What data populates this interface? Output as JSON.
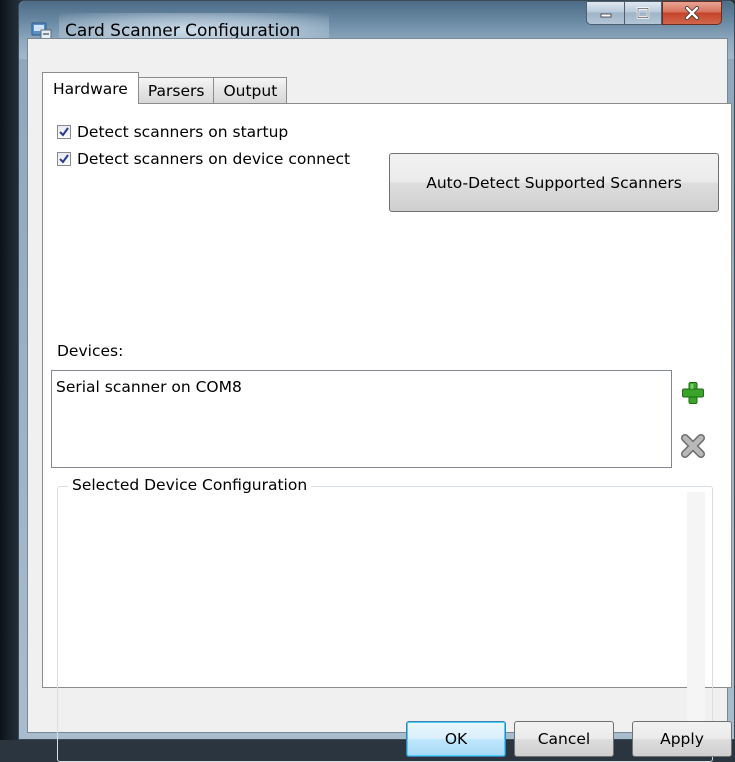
{
  "window": {
    "title": "Card Scanner Configuration"
  },
  "tabs": [
    {
      "label": "Hardware",
      "active": true
    },
    {
      "label": "Parsers",
      "active": false
    },
    {
      "label": "Output",
      "active": false
    }
  ],
  "hardware": {
    "detect_startup_label": "Detect scanners on startup",
    "detect_startup_checked": true,
    "detect_connect_label": "Detect scanners on device connect",
    "detect_connect_checked": true,
    "autodetect_label": "Auto-Detect Supported Scanners",
    "devices_label": "Devices:",
    "devices": [
      "Serial scanner on COM8"
    ],
    "selected_config_title": "Selected Device Configuration"
  },
  "footer": {
    "ok_label": "OK",
    "cancel_label": "Cancel",
    "apply_label": "Apply"
  },
  "icons": {
    "add": "plus-icon",
    "remove": "x-icon",
    "app": "app-icon"
  },
  "colors": {
    "add_green": "#3aa32a",
    "remove_gray": "#9a9a9a",
    "close_red": "#c4442a"
  }
}
